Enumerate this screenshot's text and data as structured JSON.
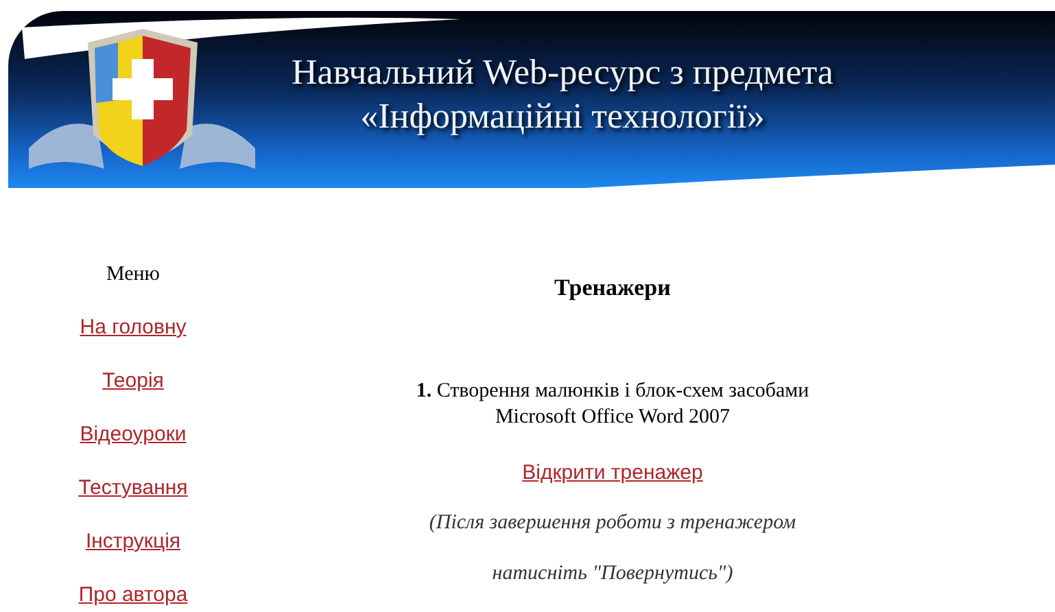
{
  "header": {
    "title_lines": [
      "Навчальний Web-ресурс з предмета",
      "«Інформаційні технології»"
    ]
  },
  "menu": {
    "title": "Меню",
    "items": [
      {
        "label": "На головну"
      },
      {
        "label": "Теорія"
      },
      {
        "label": "Відеоуроки"
      },
      {
        "label": "Тестування"
      },
      {
        "label": "Інструкція"
      },
      {
        "label": "Про автора"
      }
    ]
  },
  "main": {
    "heading": "Тренажери",
    "trainers": [
      {
        "text_lines": [
          "**1.** Створення малюнків і блок-схем засобами",
          "Microsoft Office Word 2007"
        ],
        "link": "Відкрити тренажер",
        "note_lines": [
          "(Після завершення роботи з тренажером",
          "натисніть \"Повернутись\")"
        ]
      }
    ]
  }
}
